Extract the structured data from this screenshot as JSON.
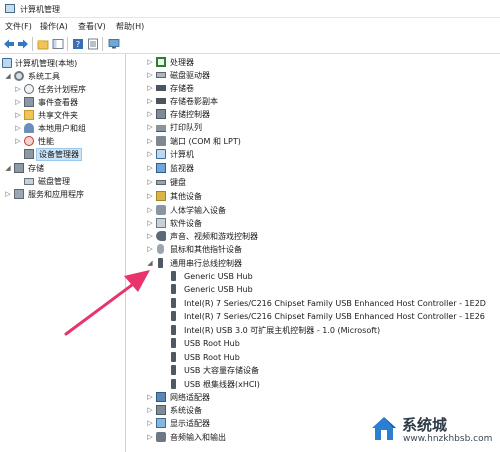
{
  "window": {
    "title": "计算机管理"
  },
  "menu": [
    {
      "label": "文件(F)"
    },
    {
      "label": "操作(A)"
    },
    {
      "label": "查看(V)"
    },
    {
      "label": "帮助(H)"
    }
  ],
  "toolbar": {
    "buttons": [
      "back-icon",
      "forward-icon",
      "up-folder-icon",
      "show-hide-tree-icon",
      "help-icon",
      "properties-icon",
      "monitor-icon"
    ]
  },
  "left_tree": [
    {
      "label": "计算机管理(本地)",
      "icon": "computer-icon"
    },
    {
      "label": "系统工具",
      "icon": "gear-icon"
    },
    {
      "label": "任务计划程序",
      "icon": "clock-icon"
    },
    {
      "label": "事件查看器",
      "icon": "event-viewer-icon"
    },
    {
      "label": "共享文件夹",
      "icon": "folder-icon"
    },
    {
      "label": "本地用户和组",
      "icon": "users-icon"
    },
    {
      "label": "性能",
      "icon": "performance-icon"
    },
    {
      "label": "设备管理器",
      "icon": "device-manager-icon",
      "selected": true
    },
    {
      "label": "存储",
      "icon": "storage-icon"
    },
    {
      "label": "磁盘管理",
      "icon": "disk-icon"
    },
    {
      "label": "服务和应用程序",
      "icon": "services-icon"
    }
  ],
  "device_categories_top": [
    {
      "label": "处理器",
      "icon": "cpu-icon"
    },
    {
      "label": "磁盘驱动器",
      "icon": "disk-drive-icon"
    },
    {
      "label": "存储卷",
      "icon": "storage-volume-icon"
    },
    {
      "label": "存储卷影副本",
      "icon": "shadow-copy-icon"
    },
    {
      "label": "存储控制器",
      "icon": "storage-controller-icon"
    },
    {
      "label": "打印队列",
      "icon": "printer-icon"
    },
    {
      "label": "端口 (COM 和 LPT)",
      "icon": "port-icon"
    },
    {
      "label": "计算机",
      "icon": "computer-icon"
    },
    {
      "label": "监视器",
      "icon": "monitor-icon"
    },
    {
      "label": "键盘",
      "icon": "keyboard-icon"
    },
    {
      "label": "其他设备",
      "icon": "other-devices-icon"
    },
    {
      "label": "人体学输入设备",
      "icon": "hid-icon"
    },
    {
      "label": "软件设备",
      "icon": "software-device-icon"
    },
    {
      "label": "声音、视频和游戏控制器",
      "icon": "audio-icon"
    },
    {
      "label": "鼠标和其他指针设备",
      "icon": "mouse-icon"
    }
  ],
  "usb_category": {
    "label": "通用串行总线控制器",
    "icon": "usb-icon",
    "children": [
      "Generic USB Hub",
      "Generic USB Hub",
      "Intel(R) 7 Series/C216 Chipset Family USB Enhanced Host Controller - 1E2D",
      "Intel(R) 7 Series/C216 Chipset Family USB Enhanced Host Controller - 1E26",
      "Intel(R) USB 3.0 可扩展主机控制器 - 1.0 (Microsoft)",
      "USB Root Hub",
      "USB Root Hub",
      "USB 大容量存储设备",
      "USB 根集线器(xHCI)"
    ]
  },
  "device_categories_bottom": [
    {
      "label": "网络适配器",
      "icon": "network-adapter-icon"
    },
    {
      "label": "系统设备",
      "icon": "system-devices-icon"
    },
    {
      "label": "显示适配器",
      "icon": "display-adapter-icon"
    },
    {
      "label": "音频输入和输出",
      "icon": "audio-io-icon"
    }
  ],
  "watermark": {
    "name": "系统城",
    "url": "www.hnzkhbsb.com"
  },
  "colors": {
    "selection": "#cce4f7",
    "arrow": "#e8336b"
  }
}
